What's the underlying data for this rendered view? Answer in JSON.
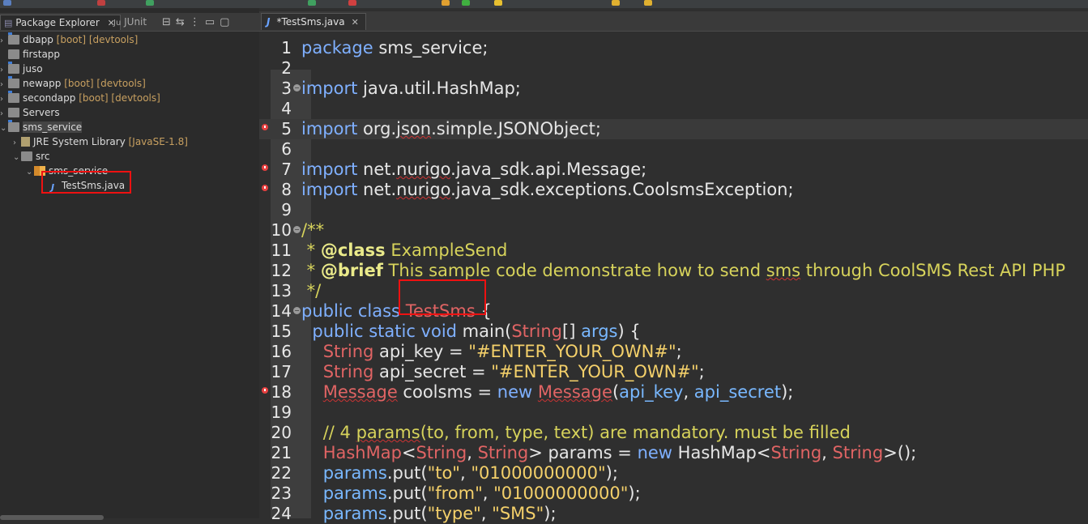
{
  "left_panel": {
    "tabs": {
      "package_explorer": "Package Explorer",
      "junit": "JUnit"
    },
    "tree": [
      {
        "name": "dbapp",
        "suffix": "[boot] [devtools]",
        "type": "proj",
        "indent": 0,
        "arrow": ">"
      },
      {
        "name": "firstapp",
        "suffix": "",
        "type": "folder",
        "indent": 0,
        "arrow": ""
      },
      {
        "name": "juso",
        "suffix": "",
        "type": "proj",
        "indent": 0,
        "arrow": ">"
      },
      {
        "name": "newapp",
        "suffix": "[boot] [devtools]",
        "type": "proj",
        "indent": 0,
        "arrow": ">"
      },
      {
        "name": "secondapp",
        "suffix": "[boot] [devtools]",
        "type": "proj",
        "indent": 0,
        "arrow": ">"
      },
      {
        "name": "Servers",
        "suffix": "",
        "type": "folder",
        "indent": 0,
        "arrow": ">"
      },
      {
        "name": "sms_service",
        "suffix": "",
        "type": "proj",
        "indent": 0,
        "arrow": "v",
        "selected": true
      },
      {
        "name": "JRE System Library",
        "suffix": "[JavaSE-1.8]",
        "type": "jre",
        "indent": 1,
        "arrow": ">"
      },
      {
        "name": "src",
        "suffix": "",
        "type": "folder",
        "indent": 1,
        "arrow": "v"
      },
      {
        "name": "sms_service",
        "suffix": "",
        "type": "pkg",
        "indent": 2,
        "arrow": "v"
      },
      {
        "name": "TestSms.java",
        "suffix": "",
        "type": "jfile",
        "indent": 3,
        "arrow": ""
      }
    ]
  },
  "editor": {
    "tab_label": "*TestSms.java",
    "lines": [
      {
        "n": "1",
        "html": "<span class='kw'>package</span> sms_service;"
      },
      {
        "n": "2",
        "html": ""
      },
      {
        "n": "3",
        "fold": true,
        "html": "<span class='kw'>import</span> java.util.HashMap;"
      },
      {
        "n": "4",
        "html": ""
      },
      {
        "n": "5",
        "marker": true,
        "highlight": true,
        "html": "<span class='kw'>import</span> org.<span class='squig'>json</span>.simple.JSONObject;"
      },
      {
        "n": "6",
        "html": ""
      },
      {
        "n": "7",
        "marker": true,
        "html": "<span class='kw'>import</span> net.<span class='squig'>nurigo</span>.java_sdk.api.Message;"
      },
      {
        "n": "8",
        "marker": true,
        "html": "<span class='kw'>import</span> net.<span class='squig'>nurigo</span>.java_sdk.exceptions.CoolsmsException;"
      },
      {
        "n": "9",
        "html": ""
      },
      {
        "n": "10",
        "fold": true,
        "html": "<span class='cm'>/**</span>"
      },
      {
        "n": "11",
        "html": "<span class='cm'> * </span><span class='tag'>@class</span><span class='cm'> ExampleSend</span>"
      },
      {
        "n": "12",
        "html": "<span class='cm'> * </span><span class='tag'>@brief</span><span class='cm'> This sample code demonstrate how to send <span class='squig'>sms</span> through CoolSMS Rest API PHP</span>"
      },
      {
        "n": "13",
        "html": "<span class='cm'> */</span>"
      },
      {
        "n": "14",
        "fold": true,
        "html": "<span class='kw'>public class</span> <span class='cls'>TestSms</span> {"
      },
      {
        "n": "15",
        "html": "  <span class='kw'>public static void</span> main(<span class='cls'>String</span>[] <span class='var'>args</span>) {"
      },
      {
        "n": "16",
        "html": "    <span class='cls'>String</span> api_key = <span class='str'>\"#ENTER_YOUR_OWN#\"</span>;"
      },
      {
        "n": "17",
        "html": "    <span class='cls'>String</span> api_secret = <span class='str'>\"#ENTER_YOUR_OWN#\"</span>;"
      },
      {
        "n": "18",
        "marker": true,
        "html": "    <span class='cls squig'>Message</span> coolsms = <span class='kw'>new</span> <span class='cls squig'>Message</span>(<span class='var'>api_key</span>, <span class='var'>api_secret</span>);"
      },
      {
        "n": "19",
        "html": ""
      },
      {
        "n": "20",
        "html": "    <span class='cm'>// 4 <span class='squig'>params</span>(to, from, type, text) are mandatory. must be filled</span>"
      },
      {
        "n": "21",
        "html": "    <span class='cls'>HashMap</span>&lt;<span class='cls'>String</span>, <span class='cls'>String</span>&gt; params = <span class='kw'>new</span> HashMap&lt;<span class='cls'>String</span>, <span class='cls'>String</span>&gt;();"
      },
      {
        "n": "22",
        "html": "    <span class='var'>params</span>.put(<span class='str'>\"to\"</span>, <span class='str'>\"01000000000\"</span>);"
      },
      {
        "n": "23",
        "html": "    <span class='var'>params</span>.put(<span class='str'>\"from\"</span>, <span class='str'>\"01000000000\"</span>);"
      },
      {
        "n": "24",
        "html": "    <span class='var'>params</span>.put(<span class='str'>\"type\"</span>, <span class='str'>\"SMS\"</span>);"
      }
    ]
  }
}
